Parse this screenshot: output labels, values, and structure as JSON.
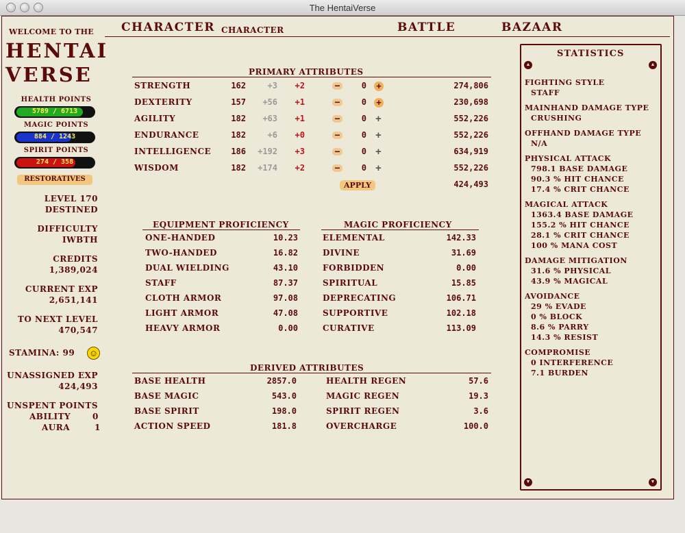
{
  "window": {
    "title": "The HentaiVerse"
  },
  "nav": {
    "character": "CHARACTER",
    "character_sub": "CHARACTER",
    "battle": "BATTLE",
    "bazaar": "BAZAAR"
  },
  "sidebar": {
    "welcome": "WELCOME TO THE",
    "logo_line1": "HENTAI",
    "logo_line2": "VERSE",
    "health_label": "HEALTH POINTS",
    "health_value": "5789 / 6713",
    "health_fraction": 0.862,
    "magic_label": "MAGIC POINTS",
    "magic_value": "884 / 1243",
    "magic_fraction": 0.711,
    "spirit_label": "SPIRIT POINTS",
    "spirit_value": "274 / 358",
    "spirit_fraction": 0.765,
    "restoratives": "RESTORATIVES",
    "level": "LEVEL 170",
    "rank": "DESTINED",
    "difficulty_label": "DIFFICULTY",
    "difficulty_value": "IWBTH",
    "credits_label": "CREDITS",
    "credits_value": "1,389,024",
    "exp_label": "CURRENT EXP",
    "exp_value": "2,651,141",
    "next_label": "TO NEXT LEVEL",
    "next_value": "470,547",
    "stamina": "STAMINA: 99",
    "unassigned_label": "UNASSIGNED EXP",
    "unassigned_value": "424,493",
    "unspent_label": "UNSPENT POINTS",
    "ability_label": "ABILITY",
    "ability_value": "0",
    "aura_label": "AURA",
    "aura_value": "1",
    "colors": {
      "health": "#22aa22",
      "magic": "#1a33cc",
      "spirit": "#cc1111"
    }
  },
  "primary": {
    "title": "PRIMARY ATTRIBUTES",
    "rows": [
      {
        "name": "STRENGTH",
        "base": "162",
        "bonus": "+3",
        "mod": "+2",
        "pts": "0",
        "exp": "274,806",
        "plus_active": true
      },
      {
        "name": "DEXTERITY",
        "base": "157",
        "bonus": "+56",
        "mod": "+1",
        "pts": "0",
        "exp": "230,698",
        "plus_active": true
      },
      {
        "name": "AGILITY",
        "base": "182",
        "bonus": "+63",
        "mod": "+1",
        "pts": "0",
        "exp": "552,226",
        "plus_active": false
      },
      {
        "name": "ENDURANCE",
        "base": "182",
        "bonus": "+6",
        "mod": "+0",
        "pts": "0",
        "exp": "552,226",
        "plus_active": false
      },
      {
        "name": "INTELLIGENCE",
        "base": "186",
        "bonus": "+192",
        "mod": "+3",
        "pts": "0",
        "exp": "634,919",
        "plus_active": false
      },
      {
        "name": "WISDOM",
        "base": "182",
        "bonus": "+174",
        "mod": "+2",
        "pts": "0",
        "exp": "552,226",
        "plus_active": false
      }
    ],
    "apply": "APPLY",
    "remaining": "424,493"
  },
  "equipment": {
    "title": "EQUIPMENT PROFICIENCY",
    "rows": [
      {
        "name": "ONE-HANDED",
        "value": "10.23"
      },
      {
        "name": "TWO-HANDED",
        "value": "16.82"
      },
      {
        "name": "DUAL WIELDING",
        "value": "43.10"
      },
      {
        "name": "STAFF",
        "value": "87.37"
      },
      {
        "name": "CLOTH ARMOR",
        "value": "97.08"
      },
      {
        "name": "LIGHT ARMOR",
        "value": "47.08"
      },
      {
        "name": "HEAVY ARMOR",
        "value": "0.00"
      }
    ]
  },
  "magic": {
    "title": "MAGIC PROFICIENCY",
    "rows": [
      {
        "name": "ELEMENTAL",
        "value": "142.33"
      },
      {
        "name": "DIVINE",
        "value": "31.69"
      },
      {
        "name": "FORBIDDEN",
        "value": "0.00"
      },
      {
        "name": "SPIRITUAL",
        "value": "15.85"
      },
      {
        "name": "DEPRECATING",
        "value": "106.71"
      },
      {
        "name": "SUPPORTIVE",
        "value": "102.18"
      },
      {
        "name": "CURATIVE",
        "value": "113.09"
      }
    ]
  },
  "derived": {
    "title": "DERIVED ATTRIBUTES",
    "left": [
      {
        "name": "BASE HEALTH",
        "value": "2857.0"
      },
      {
        "name": "BASE MAGIC",
        "value": "543.0"
      },
      {
        "name": "BASE SPIRIT",
        "value": "198.0"
      },
      {
        "name": "ACTION SPEED",
        "value": "181.8"
      }
    ],
    "right": [
      {
        "name": "HEALTH REGEN",
        "value": "57.6"
      },
      {
        "name": "MAGIC REGEN",
        "value": "19.3"
      },
      {
        "name": "SPIRIT REGEN",
        "value": "3.6"
      },
      {
        "name": "OVERCHARGE",
        "value": "100.0"
      }
    ]
  },
  "statistics": {
    "title": "STATISTICS",
    "groups": [
      {
        "head": "FIGHTING STYLE",
        "lines": [
          "STAFF"
        ]
      },
      {
        "head": "MAINHAND DAMAGE TYPE",
        "lines": [
          "CRUSHING"
        ]
      },
      {
        "head": "OFFHAND DAMAGE TYPE",
        "lines": [
          "N/A"
        ]
      },
      {
        "head": "PHYSICAL ATTACK",
        "lines": [
          "798.1 BASE DAMAGE",
          "90.3 % HIT CHANCE",
          "17.4 % CRIT CHANCE"
        ]
      },
      {
        "head": "MAGICAL ATTACK",
        "lines": [
          "1363.4 BASE DAMAGE",
          "155.2 % HIT CHANCE",
          "28.1 % CRIT CHANCE",
          "100 % MANA COST"
        ]
      },
      {
        "head": "DAMAGE MITIGATION",
        "lines": [
          "31.6 % PHYSICAL",
          "43.9 % MAGICAL"
        ]
      },
      {
        "head": "AVOIDANCE",
        "lines": [
          "29 % EVADE",
          "0 % BLOCK",
          "8.6 % PARRY",
          "14.3 % RESIST"
        ]
      },
      {
        "head": "COMPROMISE",
        "lines": [
          "0 INTERFERENCE",
          "7.1 BURDEN"
        ]
      }
    ]
  }
}
